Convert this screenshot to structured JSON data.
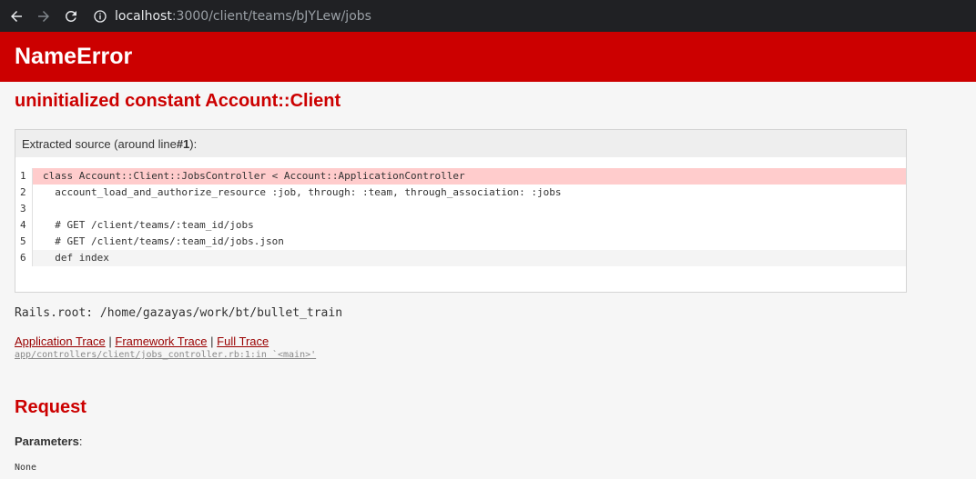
{
  "browser": {
    "url_host": "localhost",
    "url_path": ":3000/client/teams/bJYLew/jobs"
  },
  "error": {
    "title": "NameError",
    "message": "uninitialized constant Account::Client"
  },
  "source": {
    "info_prefix": "Extracted source (around line ",
    "info_line": "#1",
    "info_suffix": "):",
    "line_numbers": [
      "1",
      "2",
      "3",
      "4",
      "5",
      "6"
    ],
    "lines": [
      "class Account::Client::JobsController < Account::ApplicationController",
      "  account_load_and_authorize_resource :job, through: :team, through_association: :jobs",
      "",
      "  # GET /client/teams/:team_id/jobs",
      "  # GET /client/teams/:team_id/jobs.json",
      "  def index"
    ]
  },
  "rails_root": "Rails.root: /home/gazayas/work/bt/bullet_train",
  "trace": {
    "application": "Application Trace",
    "framework": "Framework Trace",
    "full": "Full Trace",
    "separator": "|",
    "path": "app/controllers/client/jobs_controller.rb:1:in `<main>'"
  },
  "request": {
    "heading": "Request",
    "params_label": "Parameters",
    "params_colon": ":",
    "params_value": "None"
  }
}
